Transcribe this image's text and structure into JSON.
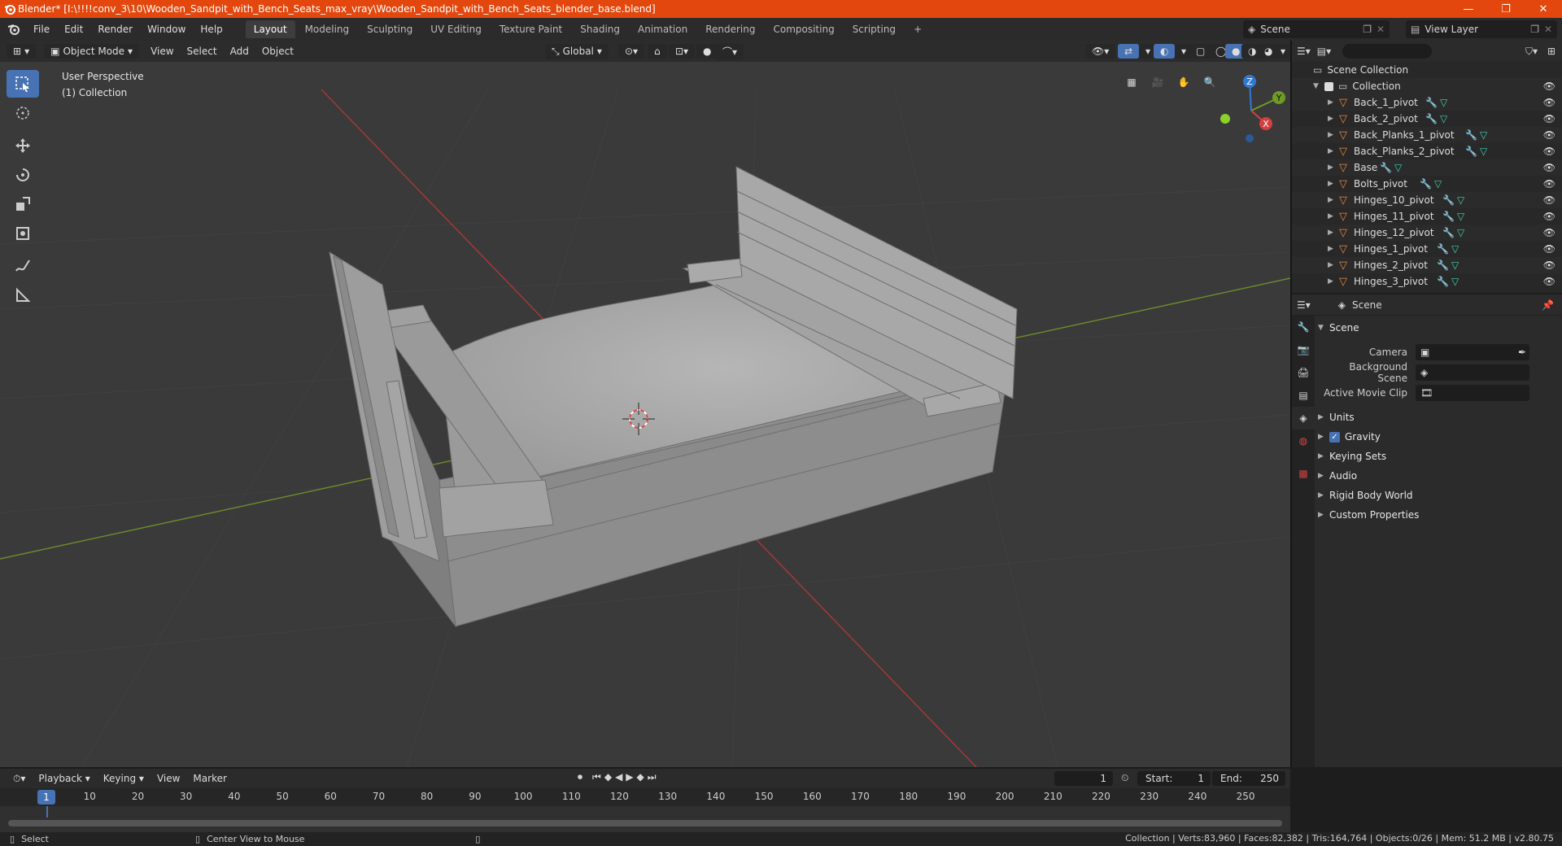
{
  "window": {
    "title": "Blender* [I:\\!!!!conv_3\\10\\Wooden_Sandpit_with_Bench_Seats_max_vray\\Wooden_Sandpit_with_Bench_Seats_blender_base.blend]",
    "minimize": "—",
    "maximize": "❐",
    "close": "✕"
  },
  "menu": {
    "items": [
      "File",
      "Edit",
      "Render",
      "Window",
      "Help"
    ],
    "workspaces": [
      "Layout",
      "Modeling",
      "Sculpting",
      "UV Editing",
      "Texture Paint",
      "Shading",
      "Animation",
      "Rendering",
      "Compositing",
      "Scripting"
    ],
    "active_workspace": "Layout",
    "add_workspace": "+",
    "scene": "Scene",
    "view_layer": "View Layer"
  },
  "viewport": {
    "mode": "Object Mode",
    "menus": [
      "View",
      "Select",
      "Add",
      "Object"
    ],
    "transform": "Global",
    "view_name": "User Perspective",
    "collection": "(1) Collection",
    "gizmo": {
      "x": "X",
      "y": "Y",
      "z": "Z"
    }
  },
  "outliner": {
    "root": "Scene Collection",
    "collection": "Collection",
    "objects": [
      "Back_1_pivot",
      "Back_2_pivot",
      "Back_Planks_1_pivot",
      "Back_Planks_2_pivot",
      "Base",
      "Bolts_pivot",
      "Hinges_10_pivot",
      "Hinges_11_pivot",
      "Hinges_12_pivot",
      "Hinges_1_pivot",
      "Hinges_2_pivot",
      "Hinges_3_pivot"
    ]
  },
  "properties": {
    "context": "Scene",
    "panel_title": "Scene",
    "fields": [
      {
        "label": "Camera",
        "value": ""
      },
      {
        "label": "Background Scene",
        "value": ""
      },
      {
        "label": "Active Movie Clip",
        "value": ""
      }
    ],
    "subpanels": [
      "Units",
      "Gravity",
      "Keying Sets",
      "Audio",
      "Rigid Body World",
      "Custom Properties"
    ],
    "gravity_checked": true
  },
  "timeline": {
    "menus": [
      "Playback",
      "Keying",
      "View",
      "Marker"
    ],
    "current_frame": "1",
    "start_label": "Start:",
    "start": "1",
    "end_label": "End:",
    "end": "250",
    "ticks": [
      "10",
      "20",
      "30",
      "40",
      "50",
      "60",
      "70",
      "80",
      "90",
      "100",
      "110",
      "120",
      "130",
      "140",
      "150",
      "160",
      "170",
      "180",
      "190",
      "200",
      "210",
      "220",
      "230",
      "240",
      "250"
    ]
  },
  "status": {
    "left": "Select",
    "middle": "Center View to Mouse",
    "stats": "Collection | Verts:83,960 | Faces:82,382 | Tris:164,764 | Objects:0/26 | Mem: 51.2 MB | v2.80.75"
  },
  "colors": {
    "titlebar": "#e3470d",
    "accent": "#4772b3",
    "object_icon": "#e8893a",
    "mesh_icon": "#3fd1b0",
    "modifier_icon": "#6fa0e6"
  }
}
